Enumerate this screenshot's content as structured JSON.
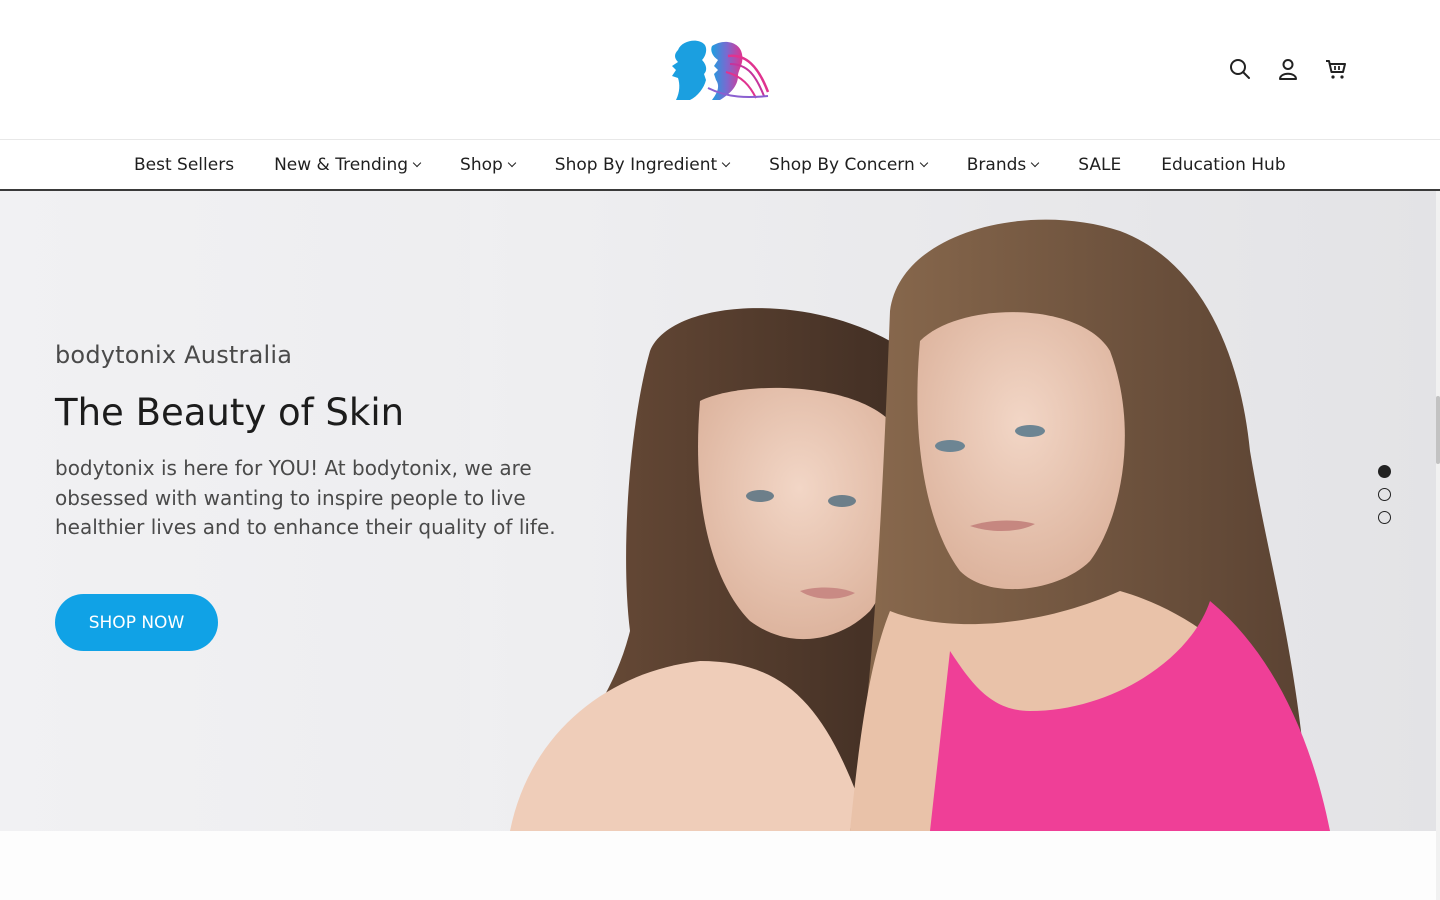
{
  "header": {
    "logo_name": "bodytonix",
    "icons": [
      "search-icon",
      "account-icon",
      "cart-icon"
    ]
  },
  "nav": {
    "items": [
      {
        "label": "Best Sellers",
        "dropdown": false
      },
      {
        "label": "New & Trending",
        "dropdown": true
      },
      {
        "label": "Shop",
        "dropdown": true
      },
      {
        "label": "Shop By Ingredient",
        "dropdown": true
      },
      {
        "label": "Shop By Concern",
        "dropdown": true
      },
      {
        "label": "Brands",
        "dropdown": true
      },
      {
        "label": "SALE",
        "dropdown": false
      },
      {
        "label": "Education Hub",
        "dropdown": false
      }
    ]
  },
  "hero": {
    "subtitle": "bodytonix Australia",
    "title": "The Beauty of Skin",
    "description": "bodytonix is here for YOU! At bodytonix, we are obsessed with wanting to inspire people to live healthier lives and to enhance their quality of life.",
    "button_label": "SHOP NOW",
    "slides_total": 3,
    "active_slide": 1
  },
  "colors": {
    "accent": "#10a2e6",
    "logo_blue": "#1b9fe0",
    "logo_pink": "#e0338f",
    "swimsuit_pink": "#ef3f97"
  }
}
